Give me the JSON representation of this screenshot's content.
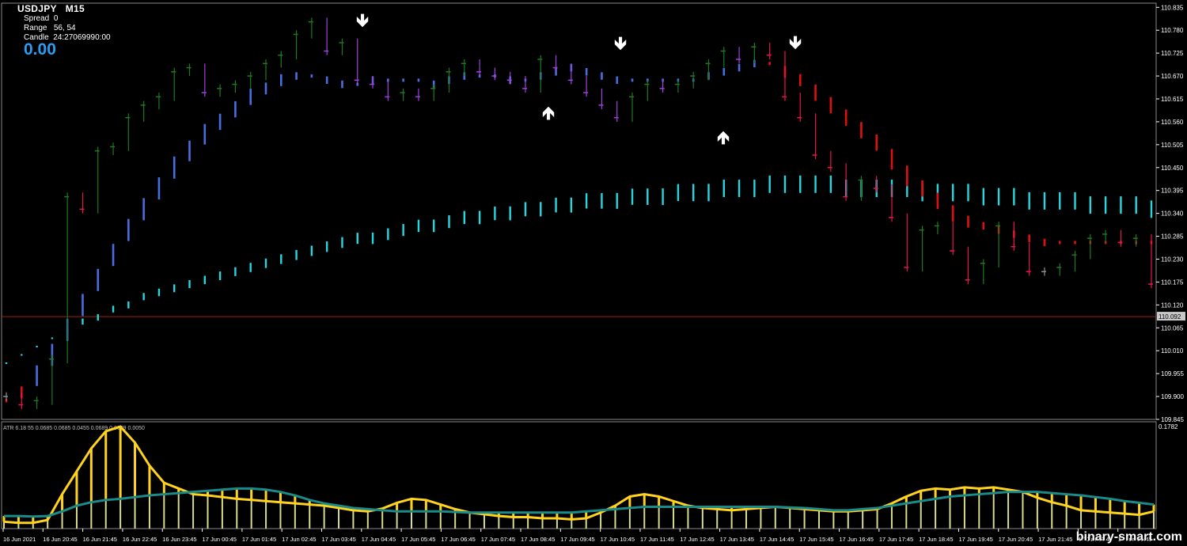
{
  "header": {
    "symbol": "USDJPY",
    "timeframe": "M15",
    "spread_label": "Spread",
    "spread_value": "0",
    "range_label": "Range",
    "range_value": "56, 54",
    "candle_label": "Candle",
    "candle_value": "24:27069990:00",
    "big_value": "0.00"
  },
  "current_price": "110.092",
  "subwindow_label": "ATR 6.18 55 0.0685 0.0685 0.0455 0.0689 0.0689 0.0050",
  "subwindow_scale_max": "0.1782",
  "watermark": "binary-smart.com",
  "arrows": [
    {
      "dir": "down",
      "glyph": "🡻"
    },
    {
      "dir": "down",
      "glyph": "🡻"
    },
    {
      "dir": "down",
      "glyph": "🡻"
    },
    {
      "dir": "up",
      "glyph": "🡹"
    },
    {
      "dir": "up",
      "glyph": "🡹"
    }
  ],
  "colors": {
    "bull": "#1f7a1f",
    "bear": "#e8154a",
    "neutral": "#8f8f8f",
    "fast_ma": "#4a6ee0",
    "slow_ma": "#27d7e0",
    "red_dots": "#e01010",
    "purple": "#a040e0",
    "atr_yellow": "#ffd21e",
    "atr_teal": "#1a8a8a",
    "price_line": "#a01f10",
    "axis": "#ffffff"
  },
  "chart_data": [
    {
      "type": "candlestick",
      "title": "USDJPY M15",
      "y_ticks": [
        "110.835",
        "110.780",
        "110.725",
        "110.670",
        "110.615",
        "110.560",
        "110.505",
        "110.450",
        "110.395",
        "110.340",
        "110.285",
        "110.230",
        "110.175",
        "110.120",
        "110.065",
        "110.010",
        "109.955",
        "109.900",
        "109.845"
      ],
      "ylim": [
        109.845,
        110.845
      ],
      "x_ticks": [
        "16 Jun 2021",
        "16 Jun 20:45",
        "16 Jun 21:45",
        "16 Jun 22:45",
        "16 Jun 23:45",
        "17 Jun 00:45",
        "17 Jun 01:45",
        "17 Jun 02:45",
        "17 Jun 03:45",
        "17 Jun 04:45",
        "17 Jun 05:45",
        "17 Jun 06:45",
        "17 Jun 07:45",
        "17 Jun 08:45",
        "17 Jun 09:45",
        "17 Jun 10:45",
        "17 Jun 11:45",
        "17 Jun 12:45",
        "17 Jun 13:45",
        "17 Jun 14:45",
        "17 Jun 15:45",
        "17 Jun 16:45",
        "17 Jun 17:45",
        "17 Jun 18:45",
        "17 Jun 19:45",
        "17 Jun 20:45",
        "17 Jun 21:45",
        "17 Jun 22:45",
        "17 Jun 23:45"
      ],
      "price_close_path": [
        109.9,
        109.88,
        109.89,
        109.99,
        110.38,
        110.35,
        110.49,
        110.5,
        110.57,
        110.6,
        110.62,
        110.68,
        110.69,
        110.63,
        110.64,
        110.65,
        110.67,
        110.7,
        110.72,
        110.77,
        110.8,
        110.73,
        110.75,
        110.66,
        110.65,
        110.62,
        110.63,
        110.62,
        110.64,
        110.68,
        110.7,
        110.68,
        110.67,
        110.66,
        110.64,
        110.71,
        110.69,
        110.66,
        110.63,
        110.6,
        110.57,
        110.62,
        110.65,
        110.64,
        110.65,
        110.67,
        110.7,
        110.73,
        110.71,
        110.74,
        110.72,
        110.62,
        110.57,
        110.48,
        110.45,
        110.38,
        110.42,
        110.4,
        110.33,
        110.21,
        110.3,
        110.31,
        110.25,
        110.18,
        110.22,
        110.31,
        110.26,
        110.2,
        110.2,
        110.21,
        110.24,
        110.28,
        110.29,
        110.27,
        110.28,
        110.17
      ],
      "fast_ma": [
        109.89,
        109.91,
        109.95,
        110.0,
        110.06,
        110.12,
        110.18,
        110.24,
        110.3,
        110.35,
        110.4,
        110.45,
        110.49,
        110.53,
        110.56,
        110.59,
        110.62,
        110.64,
        110.66,
        110.67,
        110.67,
        110.66,
        110.65,
        110.65,
        110.66,
        110.66,
        110.66,
        110.66,
        110.65,
        110.66,
        110.67,
        110.67,
        110.67,
        110.66,
        110.66,
        110.67,
        110.68,
        110.69,
        110.68,
        110.67,
        110.66,
        110.66,
        110.66,
        110.66,
        110.66,
        110.66,
        110.67,
        110.68,
        110.69,
        110.7,
        110.7,
        110.68,
        110.66,
        110.63,
        110.6,
        110.57,
        110.54,
        110.51,
        110.47,
        110.43,
        110.4,
        110.37,
        110.34,
        110.32,
        110.31,
        110.3,
        110.29,
        110.28,
        110.27,
        110.27,
        110.27,
        110.27,
        110.27,
        110.27,
        110.27,
        110.27
      ],
      "slow_ma": [
        109.98,
        110.0,
        110.02,
        110.04,
        110.06,
        110.08,
        110.09,
        110.11,
        110.12,
        110.14,
        110.15,
        110.16,
        110.17,
        110.18,
        110.19,
        110.2,
        110.21,
        110.22,
        110.23,
        110.24,
        110.25,
        110.26,
        110.27,
        110.28,
        110.28,
        110.29,
        110.3,
        110.31,
        110.31,
        110.32,
        110.33,
        110.33,
        110.34,
        110.34,
        110.35,
        110.35,
        110.36,
        110.36,
        110.37,
        110.37,
        110.37,
        110.38,
        110.38,
        110.38,
        110.39,
        110.39,
        110.39,
        110.4,
        110.4,
        110.4,
        110.41,
        110.41,
        110.41,
        110.41,
        110.41,
        110.4,
        110.4,
        110.4,
        110.4,
        110.4,
        110.39,
        110.39,
        110.39,
        110.39,
        110.38,
        110.38,
        110.38,
        110.37,
        110.37,
        110.37,
        110.37,
        110.36,
        110.36,
        110.36,
        110.36,
        110.35
      ]
    },
    {
      "type": "area",
      "title": "ATR 6.18 55",
      "ylim": [
        0,
        0.1782
      ],
      "atr_fast": [
        0.012,
        0.01,
        0.01,
        0.015,
        0.06,
        0.1,
        0.14,
        0.17,
        0.178,
        0.15,
        0.11,
        0.08,
        0.07,
        0.06,
        0.058,
        0.055,
        0.052,
        0.05,
        0.048,
        0.046,
        0.044,
        0.042,
        0.04,
        0.036,
        0.032,
        0.03,
        0.035,
        0.045,
        0.052,
        0.05,
        0.042,
        0.034,
        0.028,
        0.025,
        0.022,
        0.02,
        0.02,
        0.018,
        0.018,
        0.016,
        0.018,
        0.028,
        0.04,
        0.056,
        0.06,
        0.056,
        0.048,
        0.04,
        0.036,
        0.034,
        0.032,
        0.034,
        0.036,
        0.038,
        0.036,
        0.034,
        0.032,
        0.03,
        0.03,
        0.032,
        0.034,
        0.044,
        0.056,
        0.066,
        0.07,
        0.068,
        0.072,
        0.07,
        0.072,
        0.068,
        0.064,
        0.054,
        0.046,
        0.04,
        0.032,
        0.03,
        0.028,
        0.026,
        0.024,
        0.03
      ],
      "atr_slow": [
        0.022,
        0.022,
        0.021,
        0.022,
        0.03,
        0.04,
        0.046,
        0.05,
        0.052,
        0.055,
        0.058,
        0.06,
        0.062,
        0.064,
        0.066,
        0.068,
        0.07,
        0.07,
        0.068,
        0.064,
        0.058,
        0.05,
        0.044,
        0.04,
        0.036,
        0.034,
        0.032,
        0.03,
        0.03,
        0.03,
        0.03,
        0.029,
        0.028,
        0.028,
        0.028,
        0.028,
        0.028,
        0.028,
        0.028,
        0.028,
        0.03,
        0.032,
        0.034,
        0.036,
        0.038,
        0.038,
        0.038,
        0.038,
        0.038,
        0.038,
        0.038,
        0.038,
        0.038,
        0.038,
        0.037,
        0.036,
        0.034,
        0.032,
        0.032,
        0.034,
        0.036,
        0.04,
        0.044,
        0.048,
        0.052,
        0.056,
        0.058,
        0.06,
        0.062,
        0.064,
        0.064,
        0.064,
        0.062,
        0.06,
        0.058,
        0.055,
        0.052,
        0.048,
        0.045,
        0.042
      ]
    }
  ]
}
